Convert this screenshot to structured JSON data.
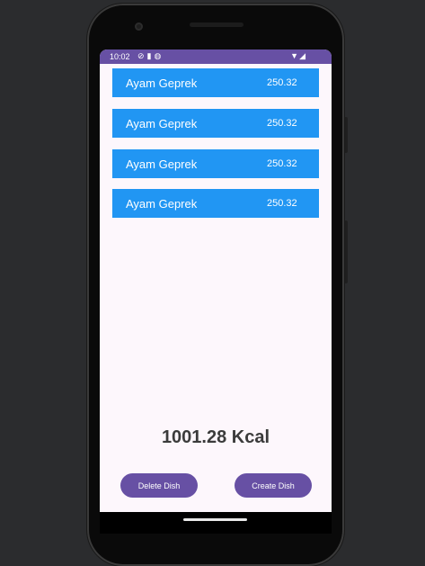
{
  "status_bar": {
    "time": "10:02",
    "left_icons": [
      "do-not-disturb-icon",
      "sd-card-icon",
      "sync-icon"
    ],
    "right_icons": [
      "wifi-icon",
      "signal-icon"
    ]
  },
  "dishes": [
    {
      "name": "Ayam Geprek",
      "calories": "250.32"
    },
    {
      "name": "Ayam Geprek",
      "calories": "250.32"
    },
    {
      "name": "Ayam Geprek",
      "calories": "250.32"
    },
    {
      "name": "Ayam Geprek",
      "calories": "250.32"
    }
  ],
  "total": "1001.28 Kcal",
  "buttons": {
    "delete_label": "Delete Dish",
    "create_label": "Create Dish"
  },
  "colors": {
    "primary": "#6750a4",
    "item_background": "#2196f3",
    "screen_background": "#fdf7fc"
  }
}
